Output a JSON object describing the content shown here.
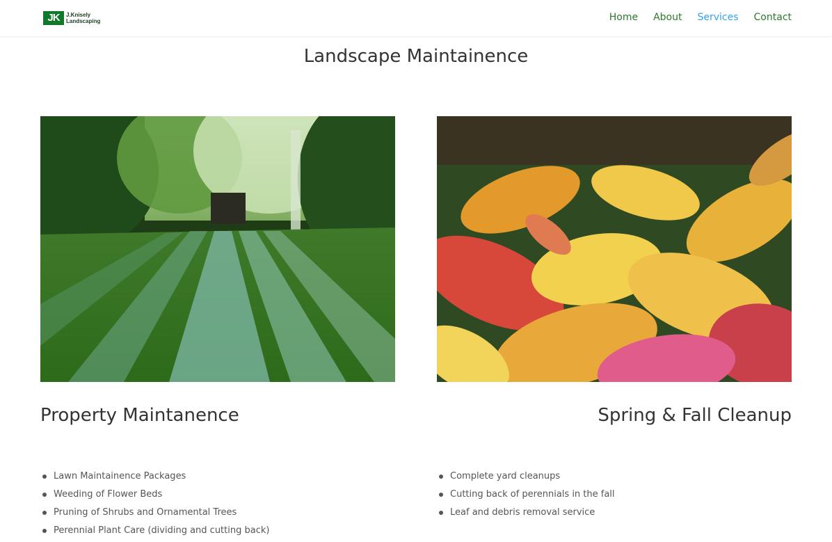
{
  "header": {
    "logo": {
      "mark": "JK",
      "line1": "J.Knisely",
      "line2": "Landscaping"
    },
    "nav": [
      {
        "label": "Home",
        "active": false
      },
      {
        "label": "About",
        "active": false
      },
      {
        "label": "Services",
        "active": true
      },
      {
        "label": "Contact",
        "active": false
      }
    ],
    "nav_color": "#2a7a2a",
    "nav_active_color": "#2ea3f2"
  },
  "page": {
    "title": "Landscape Maintainence"
  },
  "left": {
    "image": "striped-lawn-photo",
    "title": "Property Maintanence",
    "items": [
      "Lawn Maintainence Packages",
      "Weeding of Flower Beds",
      "Pruning of Shrubs and Ornamental Trees",
      "Perennial Plant Care (dividing and cutting back)"
    ]
  },
  "right": {
    "image": "autumn-leaves-photo",
    "title": "Spring & Fall Cleanup",
    "items": [
      "Complete yard cleanups",
      "Cutting back of perennials in the fall",
      "Leaf and debris removal service"
    ]
  }
}
